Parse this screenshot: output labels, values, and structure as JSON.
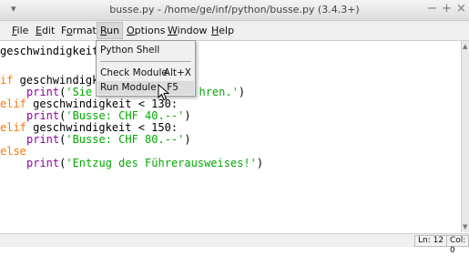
{
  "window": {
    "title": "busse.py - /home/ge/inf/python/busse.py (3.4.3+)",
    "menu_arrow": "▾",
    "controls": [
      "−",
      "+",
      "×"
    ]
  },
  "menubar": {
    "items": [
      {
        "key": "F",
        "rest": "ile"
      },
      {
        "key": "E",
        "rest": "dit"
      },
      {
        "pre": "F",
        "key": "o",
        "rest": "rmat"
      },
      {
        "key": "R",
        "rest": "un"
      },
      {
        "key": "O",
        "rest": "ptions"
      },
      {
        "key": "W",
        "rest": "indow"
      },
      {
        "key": "H",
        "rest": "elp"
      }
    ]
  },
  "run_menu": {
    "python_shell": "Python Shell",
    "check_module": "Check Module",
    "check_module_shortcut": "Alt+X",
    "run_module": "Run Module",
    "run_module_shortcut": "F5"
  },
  "code": {
    "l1": "geschwindigkeit",
    "l3_kw": "if",
    "l3_rest": " geschwindigk",
    "l4_fn": "print",
    "l4_pre": "(",
    "l4_str_a": "'Sie ",
    "l4_str_b": "hren.'",
    "l4_post": ")",
    "l5_kw": "elif",
    "l5_rest": " geschwindigkeit < 130:",
    "l6_fn": "print",
    "l6_str": "'Busse: CHF 40.--'",
    "l7_kw": "elif",
    "l7_rest": " geschwindigkeit < 150:",
    "l8_fn": "print",
    "l8_str": "'Busse: CHF 80.--'",
    "l9_kw": "else",
    "l10_fn": "print",
    "l10_str": "'Entzug des Führerausweises!'"
  },
  "status": {
    "line": "Ln: 12",
    "col": "Col: 0"
  }
}
